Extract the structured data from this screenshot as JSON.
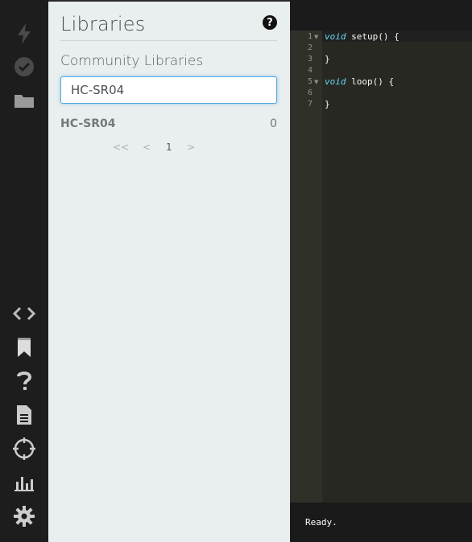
{
  "sidebar": {
    "icons": [
      {
        "name": "flash-icon"
      },
      {
        "name": "verify-icon"
      },
      {
        "name": "folder-icon"
      },
      {
        "name": "code-icon"
      },
      {
        "name": "libraries-bookmark-icon"
      },
      {
        "name": "help-icon"
      },
      {
        "name": "docs-icon"
      },
      {
        "name": "devices-target-icon"
      },
      {
        "name": "console-chart-icon"
      },
      {
        "name": "settings-gear-icon"
      }
    ]
  },
  "panel": {
    "title": "Libraries",
    "help_symbol": "?",
    "section_title": "Community Libraries",
    "search": {
      "value": "HC-SR04",
      "placeholder": ""
    },
    "results": [
      {
        "name": "HC-SR04",
        "count": "0"
      }
    ],
    "pagination": {
      "first": "<<",
      "prev": "<",
      "current": "1",
      "next": ">"
    }
  },
  "editor": {
    "line_numbers": [
      "1",
      "2",
      "3",
      "4",
      "5",
      "6",
      "7"
    ],
    "lines": [
      {
        "keyword": "void",
        "rest": " setup() {"
      },
      {
        "keyword": "",
        "rest": ""
      },
      {
        "keyword": "",
        "rest": "}"
      },
      {
        "keyword": "",
        "rest": ""
      },
      {
        "keyword": "void",
        "rest": " loop() {"
      },
      {
        "keyword": "",
        "rest": ""
      },
      {
        "keyword": "",
        "rest": "}"
      }
    ]
  },
  "console": {
    "status": "Ready."
  },
  "colors": {
    "panel_bg": "#e9eeee",
    "rail_bg": "#1d1d1d",
    "editor_bg": "#272822",
    "keyword": "#66d9ef",
    "focus_border": "#55a9e0"
  }
}
